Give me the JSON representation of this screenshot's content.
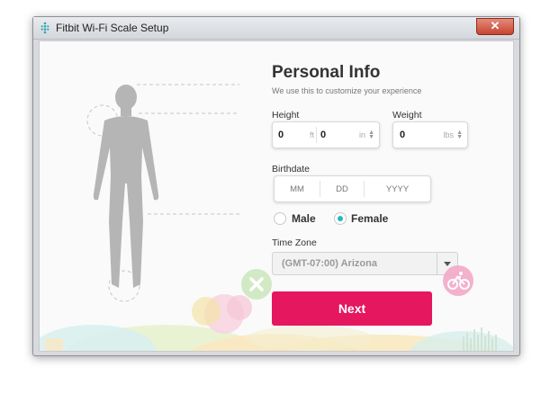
{
  "window": {
    "title": "Fitbit Wi-Fi Scale Setup",
    "close_glyph": "✕"
  },
  "form": {
    "heading": "Personal Info",
    "subtitle": "We use this to customize your experience",
    "height": {
      "label": "Height",
      "feet": "0",
      "feet_unit": "ft",
      "inches": "0",
      "inches_unit": "in"
    },
    "weight": {
      "label": "Weight",
      "value": "0",
      "unit": "lbs"
    },
    "birthdate": {
      "label": "Birthdate",
      "month_placeholder": "MM",
      "day_placeholder": "DD",
      "year_placeholder": "YYYY"
    },
    "sex": {
      "male_label": "Male",
      "female_label": "Female",
      "selected": "Female"
    },
    "timezone": {
      "label": "Time Zone",
      "value": "(GMT-07:00) Arizona"
    },
    "next_label": "Next"
  },
  "colors": {
    "accent": "#e5175e",
    "radio": "#20b9c8",
    "figure": "#b5b5b5"
  },
  "icons": [
    "fitbit-app-icon",
    "close-icon",
    "stepper-icon",
    "chevron-down-icon",
    "bike-icon",
    "cross-icon",
    "person-silhouette-icon"
  ]
}
